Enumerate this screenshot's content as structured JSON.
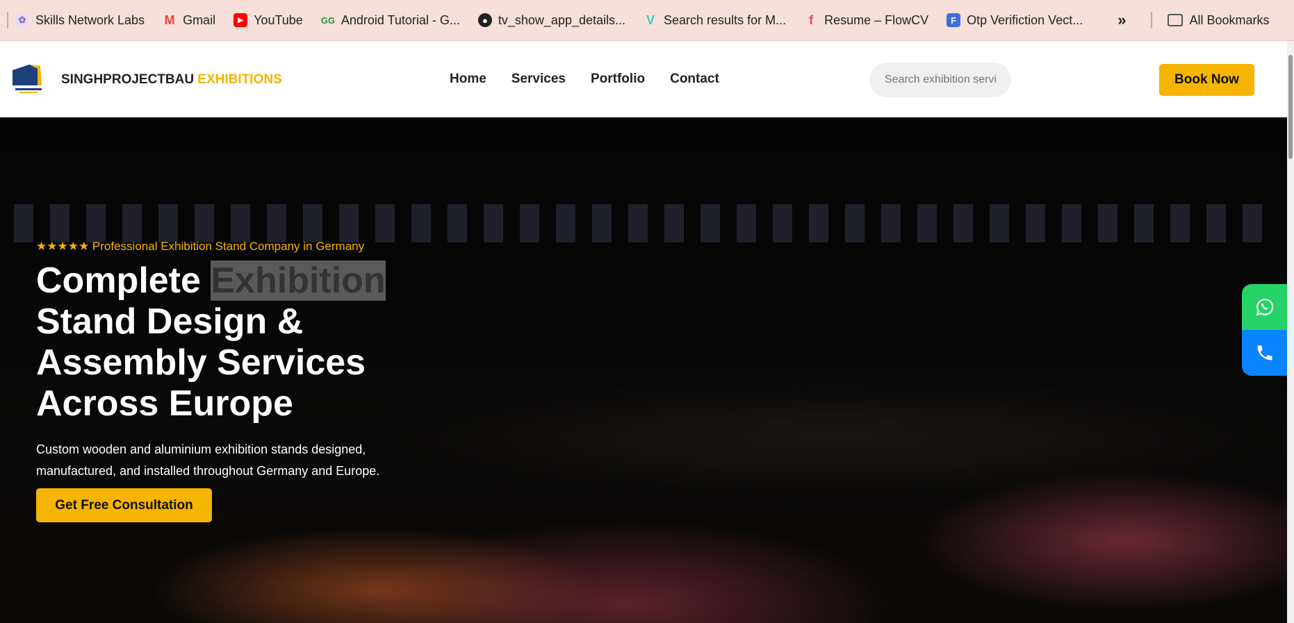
{
  "bookmarks": {
    "items": [
      {
        "label": "Skills Network Labs",
        "icon": "skills-network-icon",
        "color": "#b9a6e0"
      },
      {
        "label": "Gmail",
        "icon": "gmail-icon",
        "color": "#ea4335"
      },
      {
        "label": "YouTube",
        "icon": "youtube-icon",
        "color": "#ff0000"
      },
      {
        "label": "Android Tutorial - G...",
        "icon": "geeksforgeeks-icon",
        "color": "#2f8d46"
      },
      {
        "label": "tv_show_app_details...",
        "icon": "github-icon",
        "color": "#222222"
      },
      {
        "label": "Search results for M...",
        "icon": "vectorize-icon",
        "color": "#2dd4bf"
      },
      {
        "label": "Resume – FlowCV",
        "icon": "flowcv-icon",
        "color": "#f43f5e"
      },
      {
        "label": "Otp Verifiction Vect...",
        "icon": "freepik-icon",
        "color": "#3b6fe0"
      }
    ],
    "more": "»",
    "all": "All Bookmarks"
  },
  "header": {
    "brand_main": "SINGHPROJECTBAU",
    "brand_accent": "EXHIBITIONS",
    "nav": [
      "Home",
      "Services",
      "Portfolio",
      "Contact"
    ],
    "search_placeholder": "Search exhibition servi",
    "book": "Book Now"
  },
  "hero": {
    "tagline": "★★★★★ Professional Exhibition Stand Company in Germany",
    "title_a": "Complete ",
    "title_highlight": "Exhibition",
    "title_b": " Stand Design & Assembly Services Across Europe",
    "paragraph": "Custom wooden and aluminium exhibition stands designed, manufactured, and installed throughout Germany and Europe.",
    "cta": "Get Free Consultation"
  },
  "floating": {
    "whatsapp": "whatsapp-icon",
    "phone": "phone-icon"
  },
  "colors": {
    "accent": "#f5b400",
    "whatsapp": "#25d366",
    "phone": "#0a84ff"
  }
}
